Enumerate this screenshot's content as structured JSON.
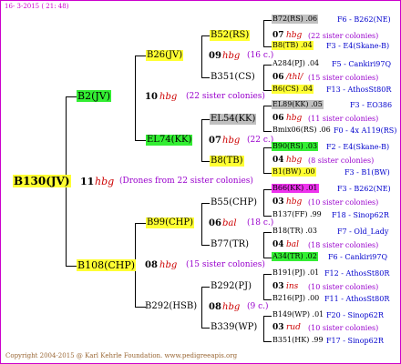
{
  "header": "16-  3-2015 ( 21: 48)",
  "footer": "Copyright 2004-2015 @ Karl Kehrle Foundation.   www.pedigreeapis.org",
  "root": {
    "name": "B130(JV)",
    "num": "11",
    "hbg": "hbg",
    "note": "(Drones from 22 sister colonies)"
  },
  "b2": {
    "name": "B2(JV)",
    "num": "10",
    "hbg": "hbg",
    "note": "(22 sister colonies)"
  },
  "b108": {
    "name": "B108(CHP)",
    "num": "08",
    "hbg": "hbg",
    "note": "(15 sister colonies)"
  },
  "b26": {
    "name": "B26(JV)",
    "num": "09",
    "hbg": "hbg",
    "note": "(16 c.)"
  },
  "el74": {
    "name": "EL74(KK)",
    "num": "07",
    "hbg": "hbg",
    "note": "(22 c.)"
  },
  "b99": {
    "name": "B99(CHP)",
    "num": "06",
    "hbg": "bal",
    "note": "(18 c.)"
  },
  "b292hsb": {
    "name": "B292(HSB)",
    "num": "08",
    "hbg": "hbg",
    "note": "(9 c.)"
  },
  "gen3": [
    {
      "name": "B52(RS)",
      "num": "07",
      "hbg": "hbg",
      "note": "(22 sister colonies)"
    },
    {
      "name": "B351(CS)",
      "num": "06",
      "hbg": "/thl/",
      "note": "(15 sister colonies)"
    },
    {
      "name": "EL54(KK)",
      "num": "06",
      "hbg": "hbg",
      "note": "(11 sister colonies)"
    },
    {
      "name": "B8(TB)",
      "num": "04",
      "hbg": "hbg",
      "note": "(8 sister colonies)"
    },
    {
      "name": "B55(CHP)",
      "num": "03",
      "hbg": "hbg",
      "note": "(10 sister colonies)"
    },
    {
      "name": "B77(TR)",
      "num": "04",
      "hbg": "bal",
      "note": "(18 sister colonies)"
    },
    {
      "name": "B292(PJ)",
      "num": "03",
      "hbg": "ins",
      "note": "(10 sister colonies)"
    },
    {
      "name": "B339(WP)",
      "num": "03",
      "hbg": "rud",
      "note": "(10 sister colonies)"
    }
  ],
  "gen4": [
    {
      "left": "B72(RS) .06",
      "right": "F6 - B262(NE)"
    },
    {
      "left": "B8(TB) .04",
      "right": "F3 - E4(Skane-B)"
    },
    {
      "left": "A284(PJ) .04",
      "right": "F5 - Cankiri97Q"
    },
    {
      "left": "B6(CS) .04",
      "right": "F13 - AthosSt80R"
    },
    {
      "left": "EL89(KK) .05",
      "right": "F3 - EO386"
    },
    {
      "left": "Bmix06(RS) .06",
      "right": "F0 - 4x A119(RS)"
    },
    {
      "left": "B90(RS) .03",
      "right": "F2 - E4(Skane-B)"
    },
    {
      "left": "B1(BW) .00",
      "right": "F3 - B1(BW)"
    },
    {
      "left": "B66(KK) .01",
      "right": "F3 - B262(NE)"
    },
    {
      "left": "B137(FF) .99",
      "right": "F18 - Sinop62R"
    },
    {
      "left": "B18(TR) .03",
      "right": "F7 - Old_Lady"
    },
    {
      "left": "A34(TR) .02",
      "right": "F6 - Cankiri97Q"
    },
    {
      "left": "B191(PJ) .01",
      "right": "F12 - AthosSt80R"
    },
    {
      "left": "B216(PJ) .00",
      "right": "F11 - AthosSt80R"
    },
    {
      "left": "B149(WP) .01",
      "right": "F20 - Sinop62R"
    },
    {
      "left": "B351(HK) .99",
      "right": "F17 - Sinop62R"
    }
  ],
  "colors": {
    "yellow": "#ffff33",
    "green": "#33ee33",
    "gray": "#c0c0c0",
    "magenta": "#ee33ee",
    "frame": "#cc00cc",
    "blue": "#0000cc",
    "purple": "#9900cc",
    "red": "#cc0000"
  }
}
